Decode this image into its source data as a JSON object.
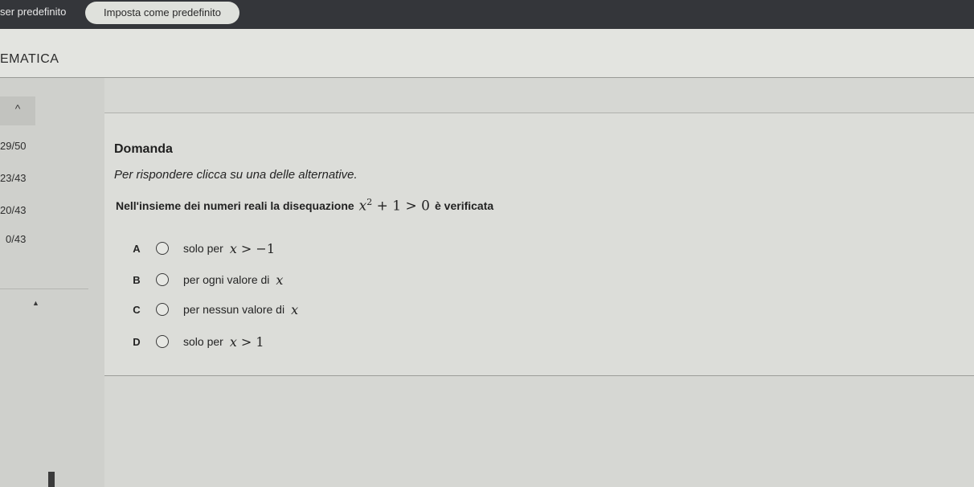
{
  "topbar": {
    "left_text": "ser predefinito",
    "set_default_button": "Imposta come predefinito"
  },
  "header": {
    "title": "EMATICA"
  },
  "sidebar": {
    "collapse_icon": "chevron-up-icon",
    "collapse_glyph": "^",
    "scores": [
      "29/50",
      "23/43",
      "20/43",
      "0/43"
    ],
    "arrow_glyph": "▲"
  },
  "question": {
    "title": "Domanda",
    "instruction": "Per rispondere clicca su una delle alternative.",
    "text_before": "Nell'insieme dei numeri reali la disequazione",
    "text_after": "è verificata",
    "answers": [
      {
        "letter": "A",
        "text": "solo per",
        "math": "x > −1"
      },
      {
        "letter": "B",
        "text": "per ogni valore di",
        "math": "x"
      },
      {
        "letter": "C",
        "text": "per nessun valore di",
        "math": "x"
      },
      {
        "letter": "D",
        "text": "solo per",
        "math": "x > 1"
      }
    ]
  }
}
